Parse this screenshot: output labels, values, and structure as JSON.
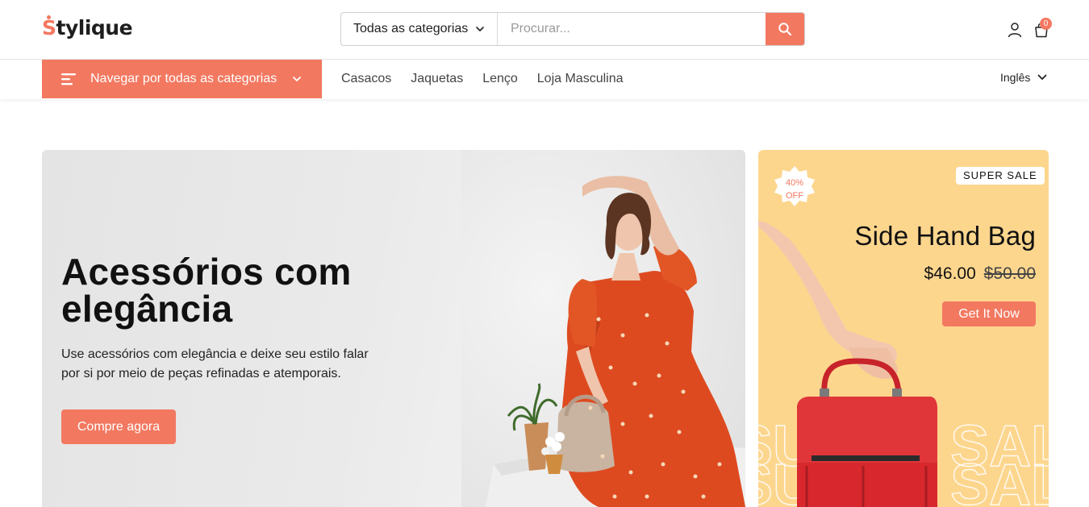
{
  "header": {
    "logo_first": "S",
    "logo_rest": "tylique",
    "search": {
      "category_label": "Todas as categorias",
      "placeholder": "Procurar..."
    },
    "cart_count": "0"
  },
  "nav": {
    "browse_label": "Navegar por todas as categorias",
    "links": [
      "Casacos",
      "Jaquetas",
      "Lenço",
      "Loja Masculina"
    ],
    "language": "Inglês"
  },
  "hero": {
    "title": "Acessórios com elegância",
    "description": "Use acessórios com elegância e deixe seu estilo falar por si por meio de peças refinadas e atemporais.",
    "cta": "Compre agora"
  },
  "promo": {
    "badge": "SUPER SALE",
    "discount_line1": "40%",
    "discount_line2": "OFF",
    "title": "Side Hand Bag",
    "price": "$46.00",
    "old_price": "$50.00",
    "cta": "Get It Now",
    "watermark": "SUPER SALE"
  },
  "colors": {
    "accent": "#f37860",
    "promo_bg": "#fdd68e"
  }
}
